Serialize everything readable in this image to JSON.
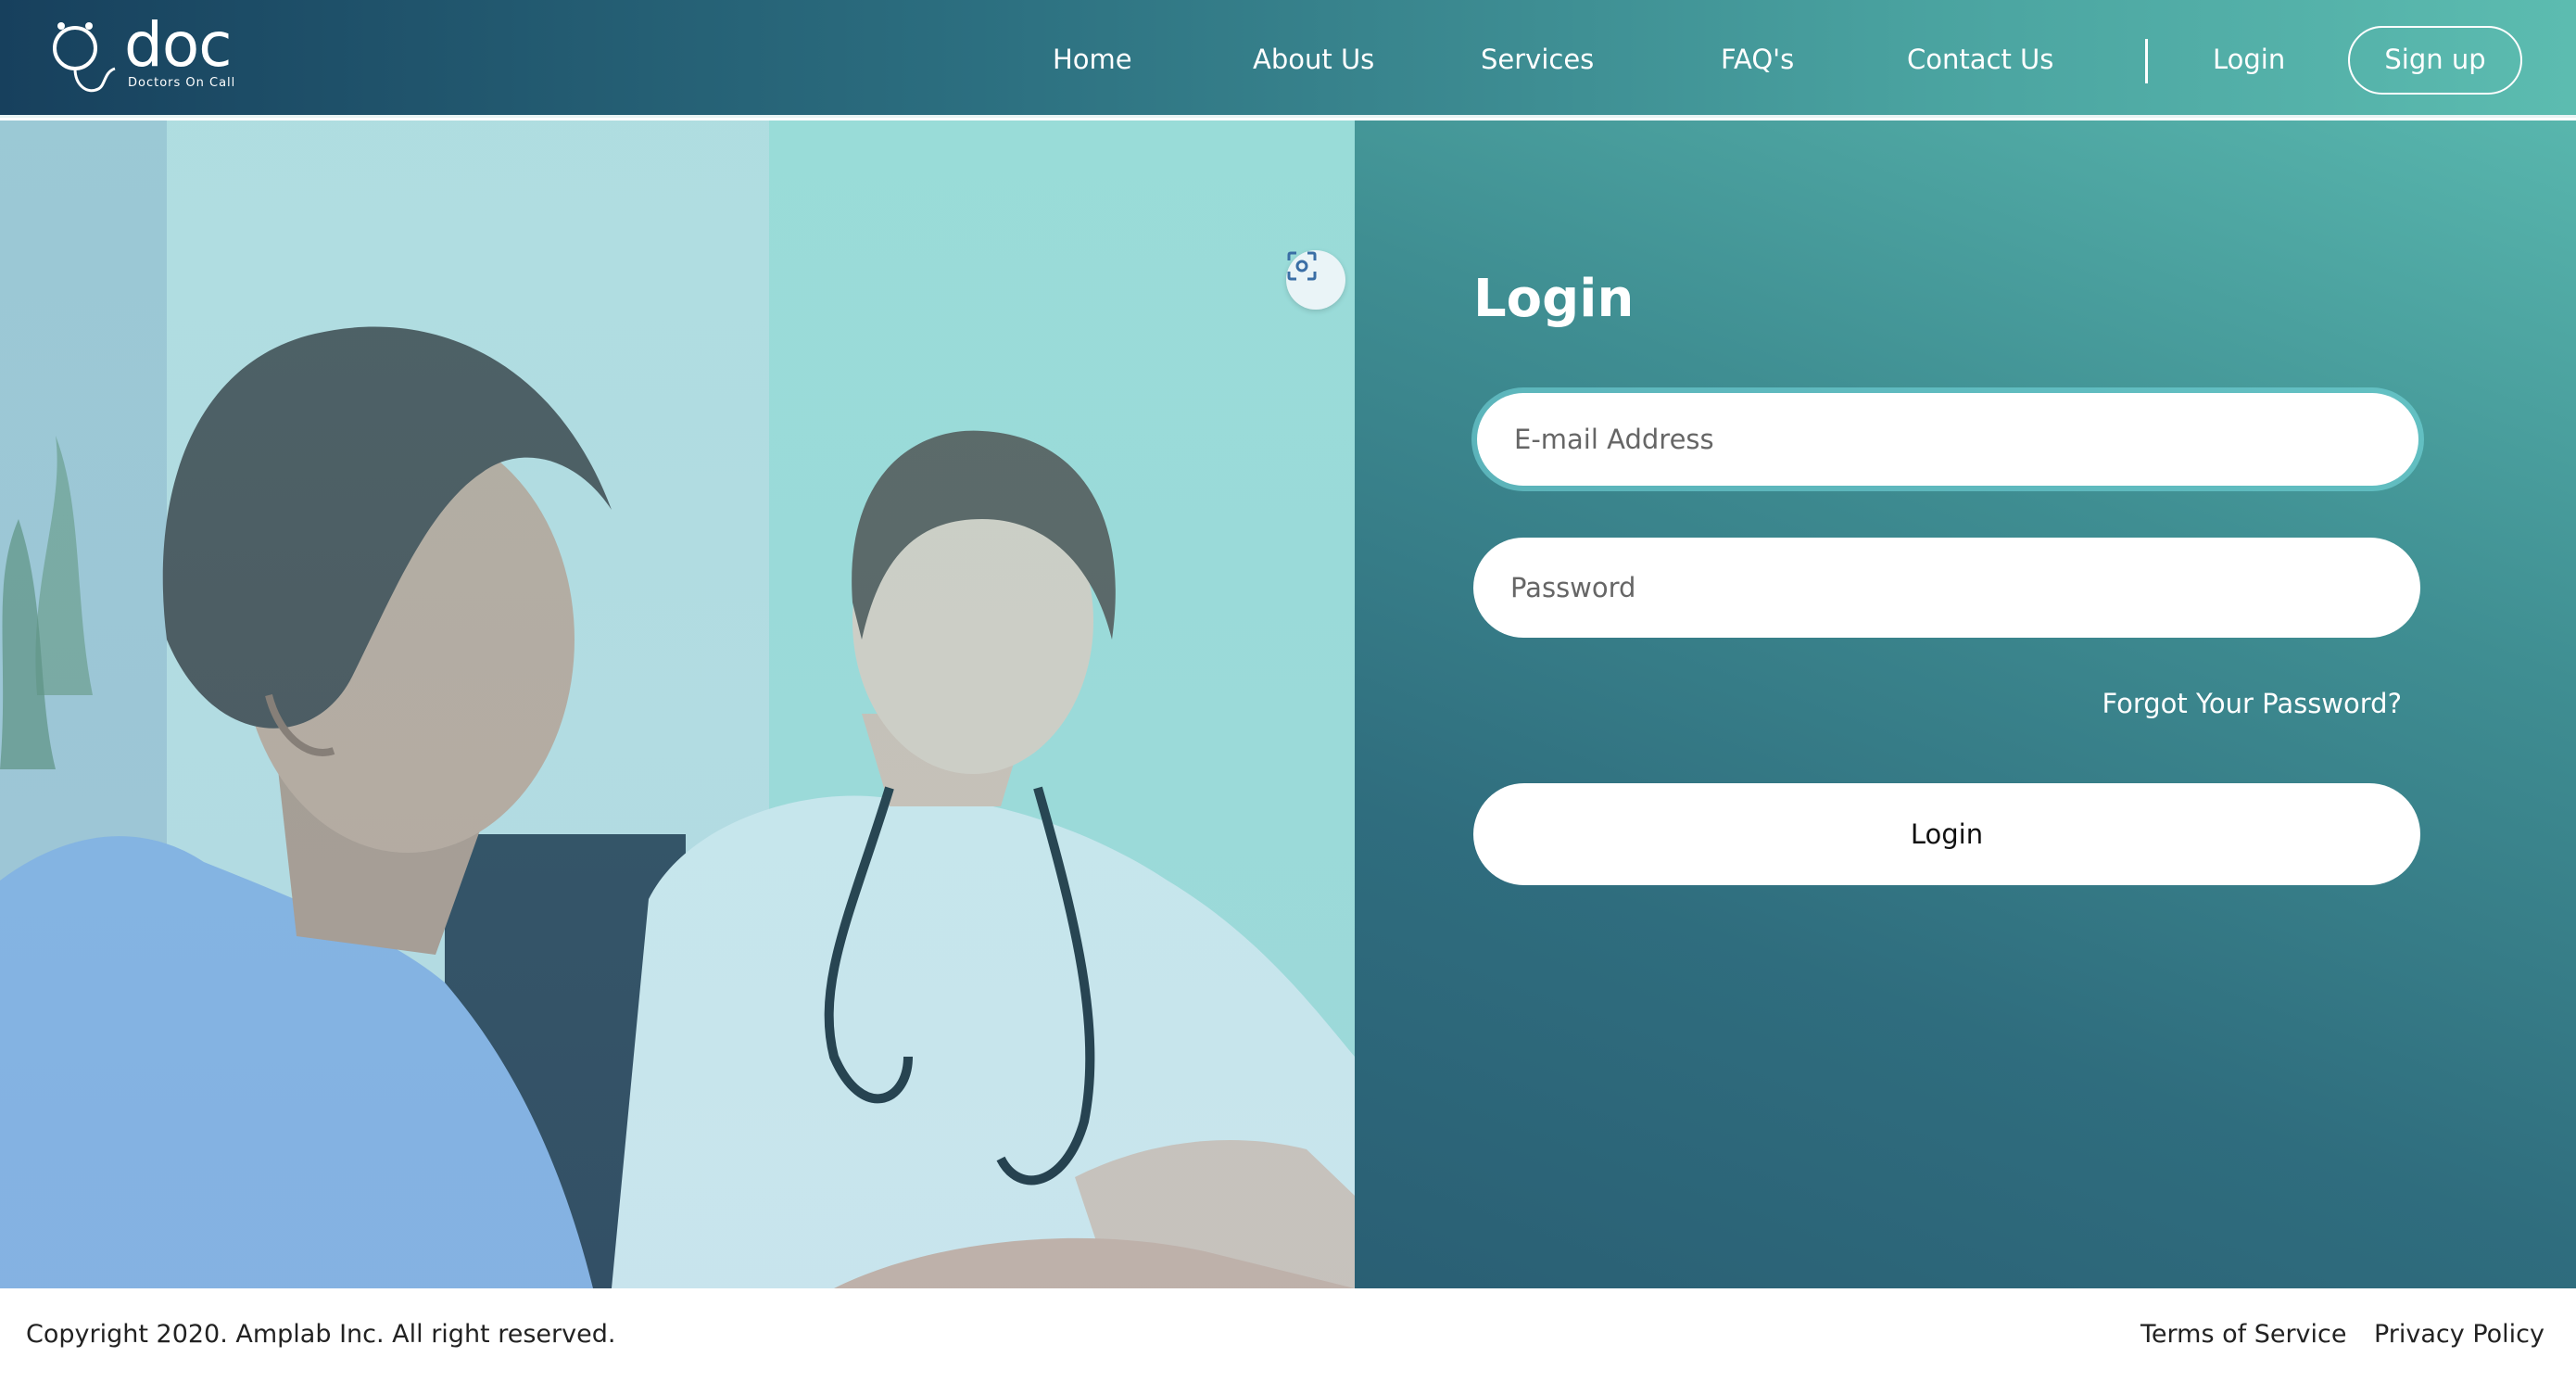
{
  "brand": {
    "logo_text": "doc",
    "tagline": "Doctors On Call"
  },
  "nav": {
    "items": [
      {
        "label": "Home"
      },
      {
        "label": "About Us"
      },
      {
        "label": "Services"
      },
      {
        "label": "FAQ's"
      },
      {
        "label": "Contact Us"
      }
    ],
    "login_label": "Login",
    "signup_label": "Sign up"
  },
  "login_form": {
    "title": "Login",
    "email_placeholder": "E-mail Address",
    "password_placeholder": "Password",
    "forgot_label": "Forgot Your Password?",
    "submit_label": "Login"
  },
  "hero": {
    "scan_icon": "scan-focus-icon"
  },
  "footer": {
    "copyright": "Copyright 2020. Amplab Inc. All right reserved.",
    "terms_label": "Terms of Service",
    "privacy_label": "Privacy Policy"
  },
  "colors": {
    "header_start": "#17405d",
    "header_end": "#5cbcb0",
    "panel_top": "#58b6ad",
    "panel_bottom": "#2a5f74"
  }
}
